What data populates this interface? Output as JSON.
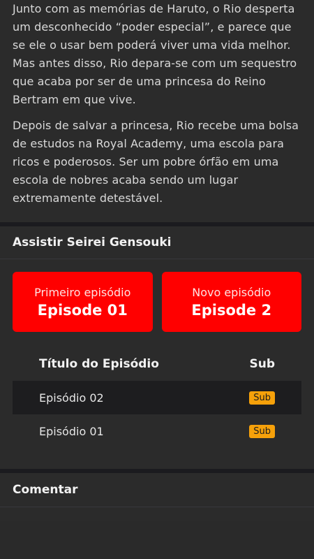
{
  "synopsis": {
    "paragraphs": [
      "Junto com as memórias de Haruto, o Rio desperta um desconhecido “poder especial”, e parece que se ele o usar bem poderá viver uma vida melhor. Mas antes disso, Rio depara-se com um sequestro que acaba por ser de uma princesa do Reino Bertram em que vive.",
      "Depois de salvar a princesa, Rio recebe uma bolsa de estudos na Royal Academy, uma escola para ricos e poderosos. Ser um pobre órfão em uma escola de nobres acaba sendo um lugar extremamente detestável."
    ]
  },
  "watch": {
    "title": "Assistir Seirei Gensouki",
    "first": {
      "label": "Primeiro episódio",
      "episode": "Episode 01"
    },
    "latest": {
      "label": "Novo episódio",
      "episode": "Episode 2"
    }
  },
  "episodes": {
    "col_title": "Título do Episódio",
    "col_sub": "Sub",
    "rows": [
      {
        "title": "Episódio 02",
        "badge": "Sub"
      },
      {
        "title": "Episódio 01",
        "badge": "Sub"
      }
    ]
  },
  "comments": {
    "title": "Comentar"
  },
  "colors": {
    "accent": "#ff0000",
    "badge": "#f6a10a",
    "background": "#2b2b2b"
  }
}
